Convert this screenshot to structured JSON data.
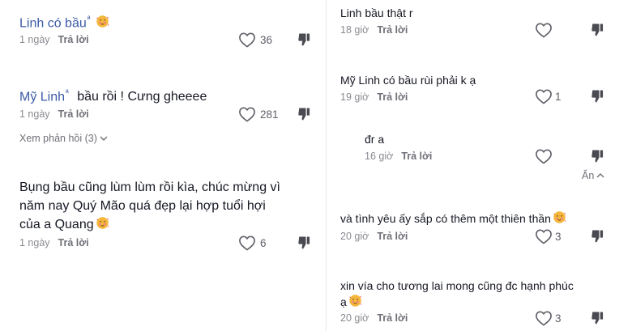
{
  "left": {
    "c1": {
      "author": "Linh có bầu",
      "tag": "ª",
      "time": "1 ngày",
      "reply": "Trả lời",
      "likes": "36"
    },
    "c2": {
      "author": "Mỹ Linh",
      "tag": "ª",
      "text": "bầu rồi ! Cưng gheeee",
      "time": "1 ngày",
      "reply": "Trả lời",
      "likes": "281",
      "view_replies": "Xem phản hồi (3)"
    },
    "c3": {
      "line1": "Bụng bầu cũng lùm lùm rồi kìa, chúc mừng vì",
      "line2": "năm nay Quý Mão quá đẹp lại hợp tuổi hợi",
      "line3": "của a Quang",
      "time": "1 ngày",
      "reply": "Trả lời",
      "likes": "6"
    }
  },
  "right": {
    "r1": {
      "text": "Linh bầu thật r",
      "time": "18 giờ",
      "reply": "Trả lời"
    },
    "r2": {
      "text": "Mỹ Linh có bầu rùi phải k ạ",
      "time": "19 giờ",
      "reply": "Trả lời",
      "likes": "1"
    },
    "r3": {
      "text": "đr a",
      "time": "16 giờ",
      "reply": "Trả lời"
    },
    "hide": "Ẩn",
    "r4": {
      "text": "và tình yêu ấy sắp có thêm một thiên thần",
      "time": "20 giờ",
      "reply": "Trả lời",
      "likes": "3"
    },
    "r5": {
      "line1": "xin vía cho tương lai mong cũng đc hạnh phúc",
      "line2": "ạ",
      "time": "20 giờ",
      "reply": "Trả lời",
      "likes": "3"
    }
  },
  "colors": {
    "author": "#3b5ba5",
    "muted": "#8a8b91",
    "text": "#161823"
  }
}
